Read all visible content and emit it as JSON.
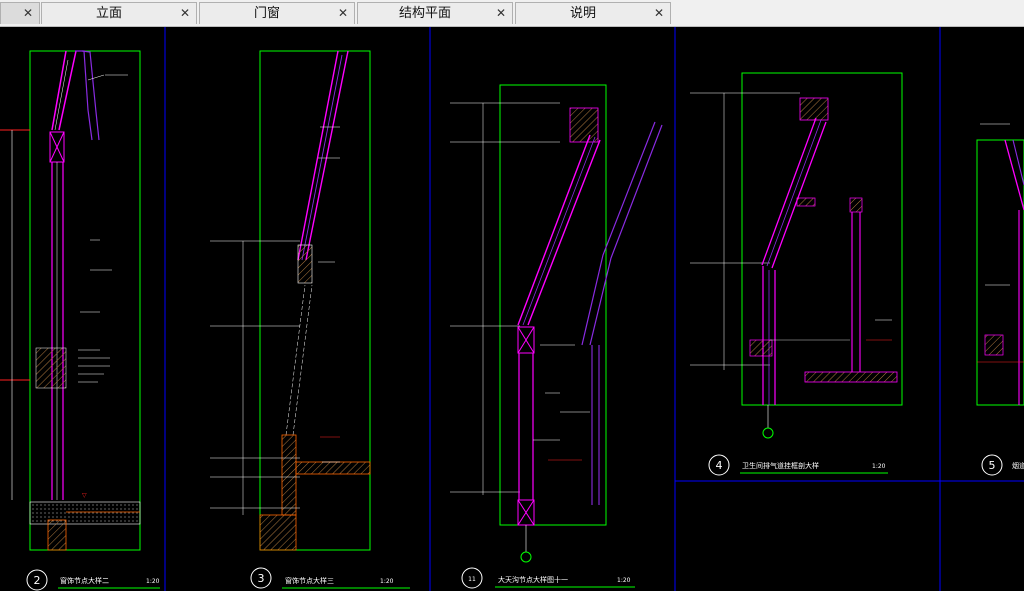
{
  "tabs": [
    {
      "label": "",
      "close": "✕"
    },
    {
      "label": "立面",
      "close": "✕"
    },
    {
      "label": "门窗",
      "close": "✕"
    },
    {
      "label": "结构平面",
      "close": "✕"
    },
    {
      "label": "说明",
      "close": "✕"
    }
  ],
  "details": [
    {
      "number": "2",
      "title": "窗饰节点大样二",
      "scale": "1:20"
    },
    {
      "number": "3",
      "title": "窗饰节点大样三",
      "scale": "1:20"
    },
    {
      "number": "11",
      "title": "大天沟节点大样图十一",
      "scale": "1:20"
    },
    {
      "number": "4",
      "title": "卫生间排气道挂框剖大样",
      "scale": "1:20"
    },
    {
      "number": "5",
      "title": "烟道",
      "scale": ""
    }
  ],
  "colors": {
    "frame": "#00ff00",
    "divider": "#0000ff",
    "magenta": "#ff00ff",
    "purple": "#8a2be2",
    "red": "#ff2020",
    "white": "#ffffff",
    "hatch": "#b07a40"
  }
}
